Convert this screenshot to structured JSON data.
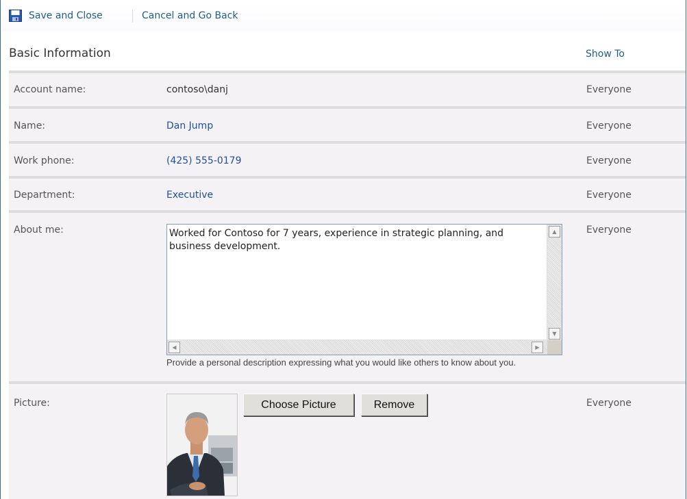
{
  "toolbar": {
    "save_label": "Save and Close",
    "cancel_label": "Cancel and Go Back"
  },
  "section": {
    "title": "Basic Information",
    "show_to_header": "Show To"
  },
  "fields": {
    "account": {
      "label": "Account name:",
      "value": "contoso\\danj",
      "show_to": "Everyone"
    },
    "name": {
      "label": "Name:",
      "value": "Dan Jump",
      "show_to": "Everyone"
    },
    "work_phone": {
      "label": "Work phone:",
      "value": "(425) 555-0179",
      "show_to": "Everyone"
    },
    "department": {
      "label": "Department:",
      "value": "Executive",
      "show_to": "Everyone"
    },
    "about_me": {
      "label": "About me:",
      "value": "Worked for Contoso for 7 years, experience in strategic planning, and business development.",
      "hint": "Provide a personal description expressing what you would like others to know about you.",
      "show_to": "Everyone"
    },
    "picture": {
      "label": "Picture:",
      "choose_label": "Choose Picture",
      "remove_label": "Remove",
      "show_to": "Everyone"
    }
  },
  "icons": {
    "save": "floppy-disk-icon"
  },
  "colors": {
    "link": "#1f4f9c",
    "toolbar_link": "#1f5d8c",
    "row_bg": "#f4f2f4",
    "rule": "#dcdcdc"
  }
}
